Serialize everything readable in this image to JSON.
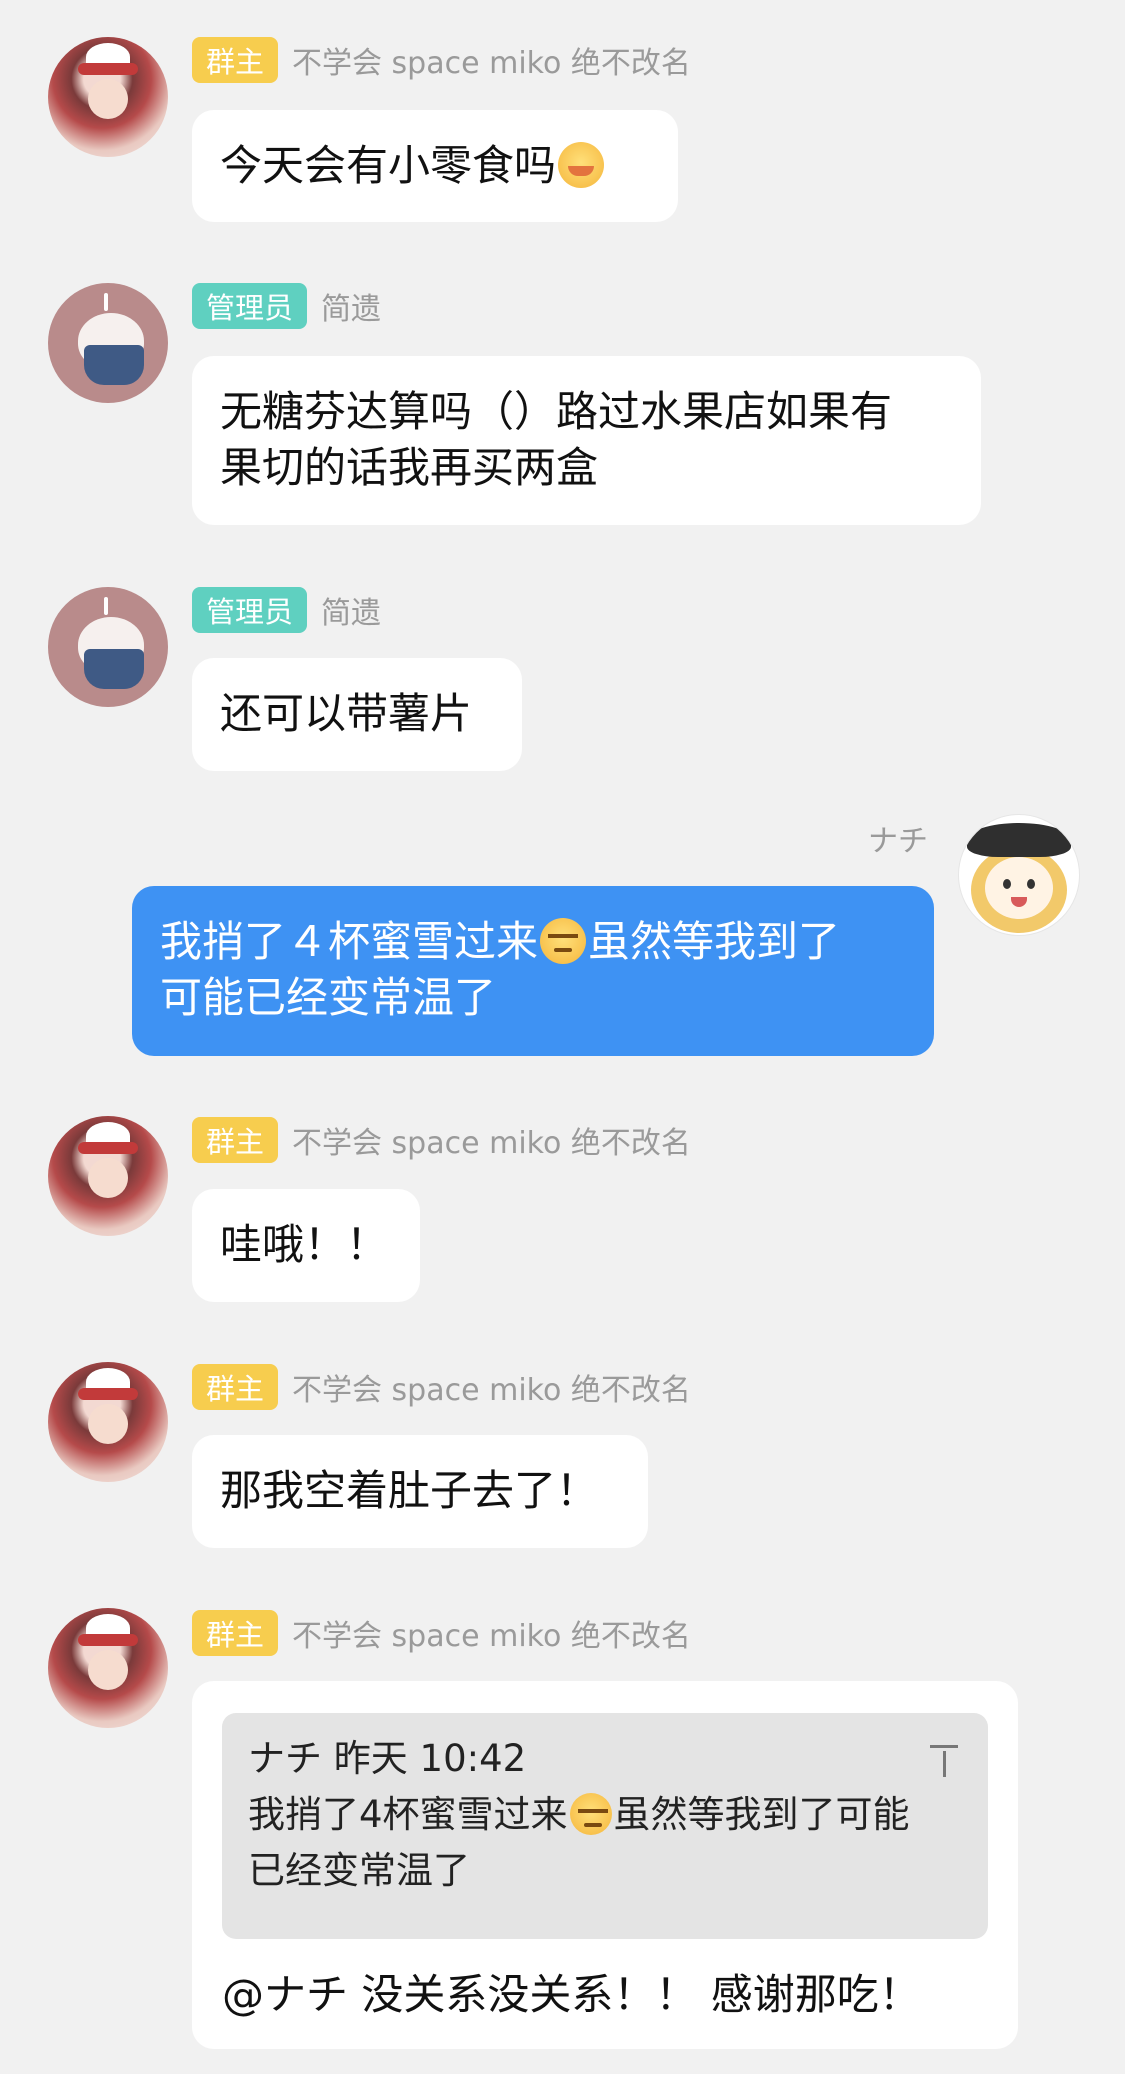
{
  "messages": [
    {
      "badge": "群主",
      "sender": "不学会 space miko 绝不改名",
      "lines": [
        "今天会有小零食吗"
      ],
      "emoji": "shy-face-emoji"
    },
    {
      "badge": "管理员",
      "sender": "简遗",
      "lines": [
        "无糖芬达算吗（）路过水果店如果有",
        "果切的话我再买两盒"
      ]
    },
    {
      "badge": "管理员",
      "sender": "简遗",
      "lines": [
        "还可以带薯片"
      ]
    },
    {
      "sender": "ナチ",
      "line1_a": "我捎了４杯蜜雪过来",
      "line1_b": "虽然等我到了",
      "line2": "可能已经变常温了",
      "emoji": "grumpy-face-emoji"
    },
    {
      "badge": "群主",
      "sender": "不学会 space miko 绝不改名",
      "lines": [
        "哇哦！！"
      ]
    },
    {
      "badge": "群主",
      "sender": "不学会 space miko 绝不改名",
      "lines": [
        "那我空着肚子去了！"
      ]
    },
    {
      "badge": "群主",
      "sender": "不学会 space miko 绝不改名",
      "quote": {
        "header": "ナチ 昨天 10:42",
        "line1_a": "我捎了4杯蜜雪过来",
        "line1_b": "虽然等我到了可能",
        "line2": "已经变常温了",
        "icon": "pin-to-top-icon"
      },
      "reply": "@ナチ 没关系没关系！！ 感谢那吃！"
    }
  ],
  "colors": {
    "background": "#f1f1f1",
    "bubble": "#ffffff",
    "my_bubble": "#3e92f3",
    "owner_badge": "#f7cd4e",
    "admin_badge": "#5fd0c0",
    "sender_name": "#9a9a9a",
    "quote_bg": "#e4e4e4"
  }
}
